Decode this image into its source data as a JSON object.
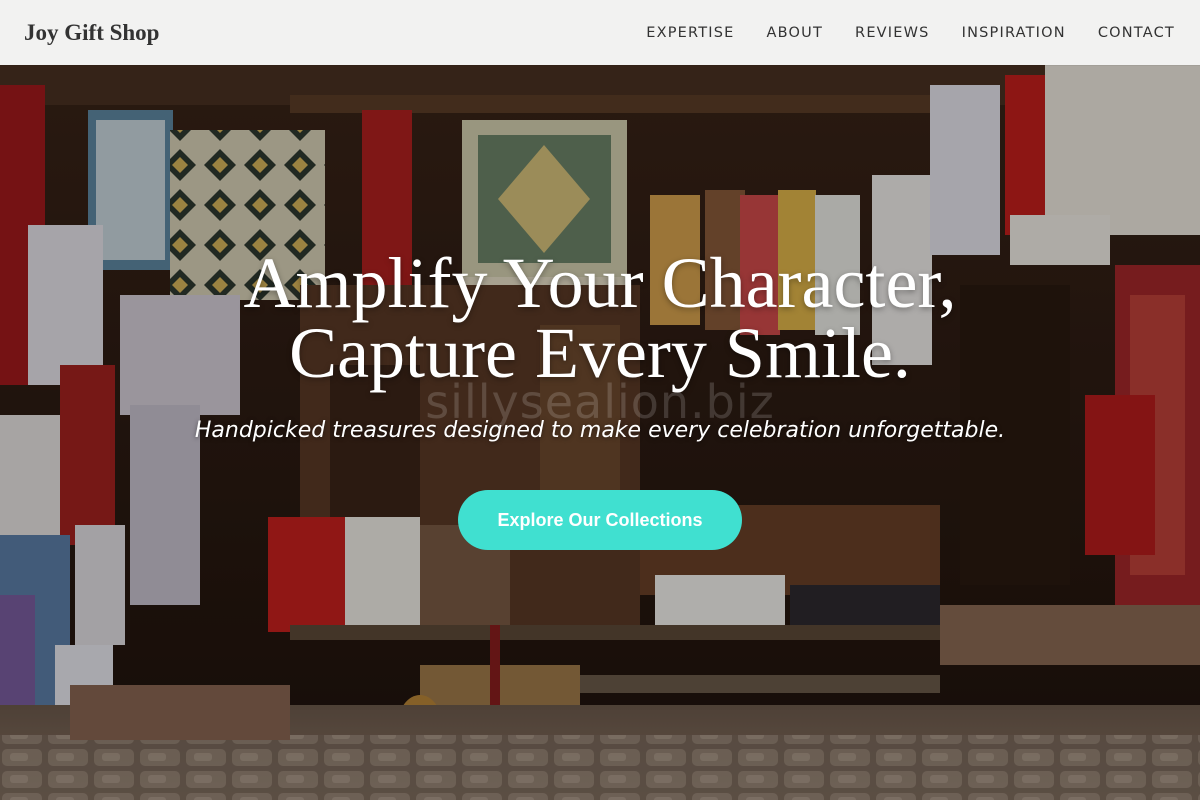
{
  "header": {
    "logo": "Joy Gift Shop",
    "nav": [
      "EXPERTISE",
      "ABOUT",
      "REVIEWS",
      "INSPIRATION",
      "CONTACT"
    ]
  },
  "hero": {
    "title_line1": "Amplify Your Character,",
    "title_line2": "Capture Every Smile.",
    "subtitle": "Handpicked treasures designed to make every celebration unforgettable.",
    "cta_label": "Explore Our Collections",
    "watermark": "sillysealion.biz"
  },
  "colors": {
    "header_bg": "#f2f2f1",
    "accent": "#40e0d0",
    "text_dark": "#333333",
    "text_light": "#ffffff"
  }
}
